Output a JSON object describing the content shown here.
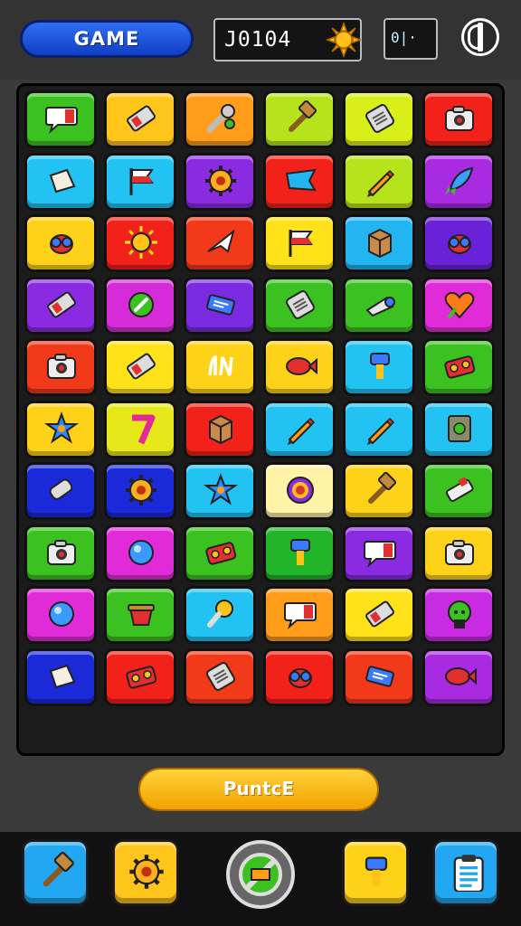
{
  "header": {
    "game_label": "GAME",
    "score": "J0104",
    "mini_readout": "0|·"
  },
  "action_button_label": "PuntcE",
  "board": {
    "columns": 6,
    "rows": 10,
    "tiles": [
      {
        "color": "#3cc220",
        "icon": "speech-bubble"
      },
      {
        "color": "#ffc51a",
        "icon": "battery"
      },
      {
        "color": "#ff9c1a",
        "icon": "wrench"
      },
      {
        "color": "#b7e31c",
        "icon": "hammer"
      },
      {
        "color": "#d8ef1a",
        "icon": "chip"
      },
      {
        "color": "#f2221a",
        "icon": "camera"
      },
      {
        "color": "#22c3f2",
        "icon": "bag"
      },
      {
        "color": "#22c3f2",
        "icon": "flag"
      },
      {
        "color": "#8a2be2",
        "icon": "gear"
      },
      {
        "color": "#f2221a",
        "icon": "pennant"
      },
      {
        "color": "#b7e31c",
        "icon": "pencil"
      },
      {
        "color": "#a82be2",
        "icon": "rocket"
      },
      {
        "color": "#ffd21a",
        "icon": "bug"
      },
      {
        "color": "#f2221a",
        "icon": "sun"
      },
      {
        "color": "#f23a1a",
        "icon": "arrow"
      },
      {
        "color": "#ffe21a",
        "icon": "flag"
      },
      {
        "color": "#22b5f2",
        "icon": "box"
      },
      {
        "color": "#6a22d8",
        "icon": "bug"
      },
      {
        "color": "#8a2be2",
        "icon": "battery"
      },
      {
        "color": "#d62bd8",
        "icon": "compass"
      },
      {
        "color": "#7a2be2",
        "icon": "tag"
      },
      {
        "color": "#3cc220",
        "icon": "chip"
      },
      {
        "color": "#3cc220",
        "icon": "horn"
      },
      {
        "color": "#e22bd8",
        "icon": "heart"
      },
      {
        "color": "#f23a1a",
        "icon": "camera"
      },
      {
        "color": "#ffe21a",
        "icon": "battery"
      },
      {
        "color": "#ffd21a",
        "icon": "letters"
      },
      {
        "color": "#ffd21a",
        "icon": "fish"
      },
      {
        "color": "#22c3f2",
        "icon": "brush"
      },
      {
        "color": "#3cc220",
        "icon": "radio"
      },
      {
        "color": "#ffd21a",
        "icon": "star"
      },
      {
        "color": "#e6e81a",
        "icon": "seven"
      },
      {
        "color": "#f2221a",
        "icon": "box"
      },
      {
        "color": "#22c3f2",
        "icon": "pencil"
      },
      {
        "color": "#22c3f2",
        "icon": "pencil"
      },
      {
        "color": "#22c3f2",
        "icon": "book"
      },
      {
        "color": "#1a2ad8",
        "icon": "bottle"
      },
      {
        "color": "#1a2ad8",
        "icon": "gear"
      },
      {
        "color": "#22c3f2",
        "icon": "star"
      },
      {
        "color": "#fff3a8",
        "icon": "target"
      },
      {
        "color": "#ffd21a",
        "icon": "hammer"
      },
      {
        "color": "#3cc220",
        "icon": "usb"
      },
      {
        "color": "#3cc220",
        "icon": "camera"
      },
      {
        "color": "#e22bd8",
        "icon": "orb"
      },
      {
        "color": "#3cc220",
        "icon": "radio"
      },
      {
        "color": "#22b52a",
        "icon": "brush"
      },
      {
        "color": "#8a2be2",
        "icon": "speech-bubble"
      },
      {
        "color": "#ffd21a",
        "icon": "camera"
      },
      {
        "color": "#e22bd8",
        "icon": "orb"
      },
      {
        "color": "#3cc220",
        "icon": "pot"
      },
      {
        "color": "#22c3f2",
        "icon": "pacifier"
      },
      {
        "color": "#ff9c1a",
        "icon": "speech-bubble"
      },
      {
        "color": "#ffe21a",
        "icon": "battery"
      },
      {
        "color": "#c82be2",
        "icon": "plant"
      },
      {
        "color": "#1a2ad8",
        "icon": "bag"
      },
      {
        "color": "#f2221a",
        "icon": "radio"
      },
      {
        "color": "#f23a1a",
        "icon": "chip"
      },
      {
        "color": "#f2221a",
        "icon": "bug"
      },
      {
        "color": "#f23a1a",
        "icon": "tag"
      },
      {
        "color": "#a82be2",
        "icon": "fish"
      }
    ]
  },
  "toolbar": [
    {
      "name": "hammer-tool",
      "color": "#22a8f2",
      "icon": "hammer"
    },
    {
      "name": "gear-tool",
      "color": "#ffc51a",
      "icon": "gear"
    },
    {
      "name": "no-entry-tool",
      "color": "#666666",
      "icon": "no-entry"
    },
    {
      "name": "brush-tool",
      "color": "#ffd21a",
      "icon": "brush"
    },
    {
      "name": "clipboard-tool",
      "color": "#22a8f2",
      "icon": "clipboard"
    }
  ]
}
